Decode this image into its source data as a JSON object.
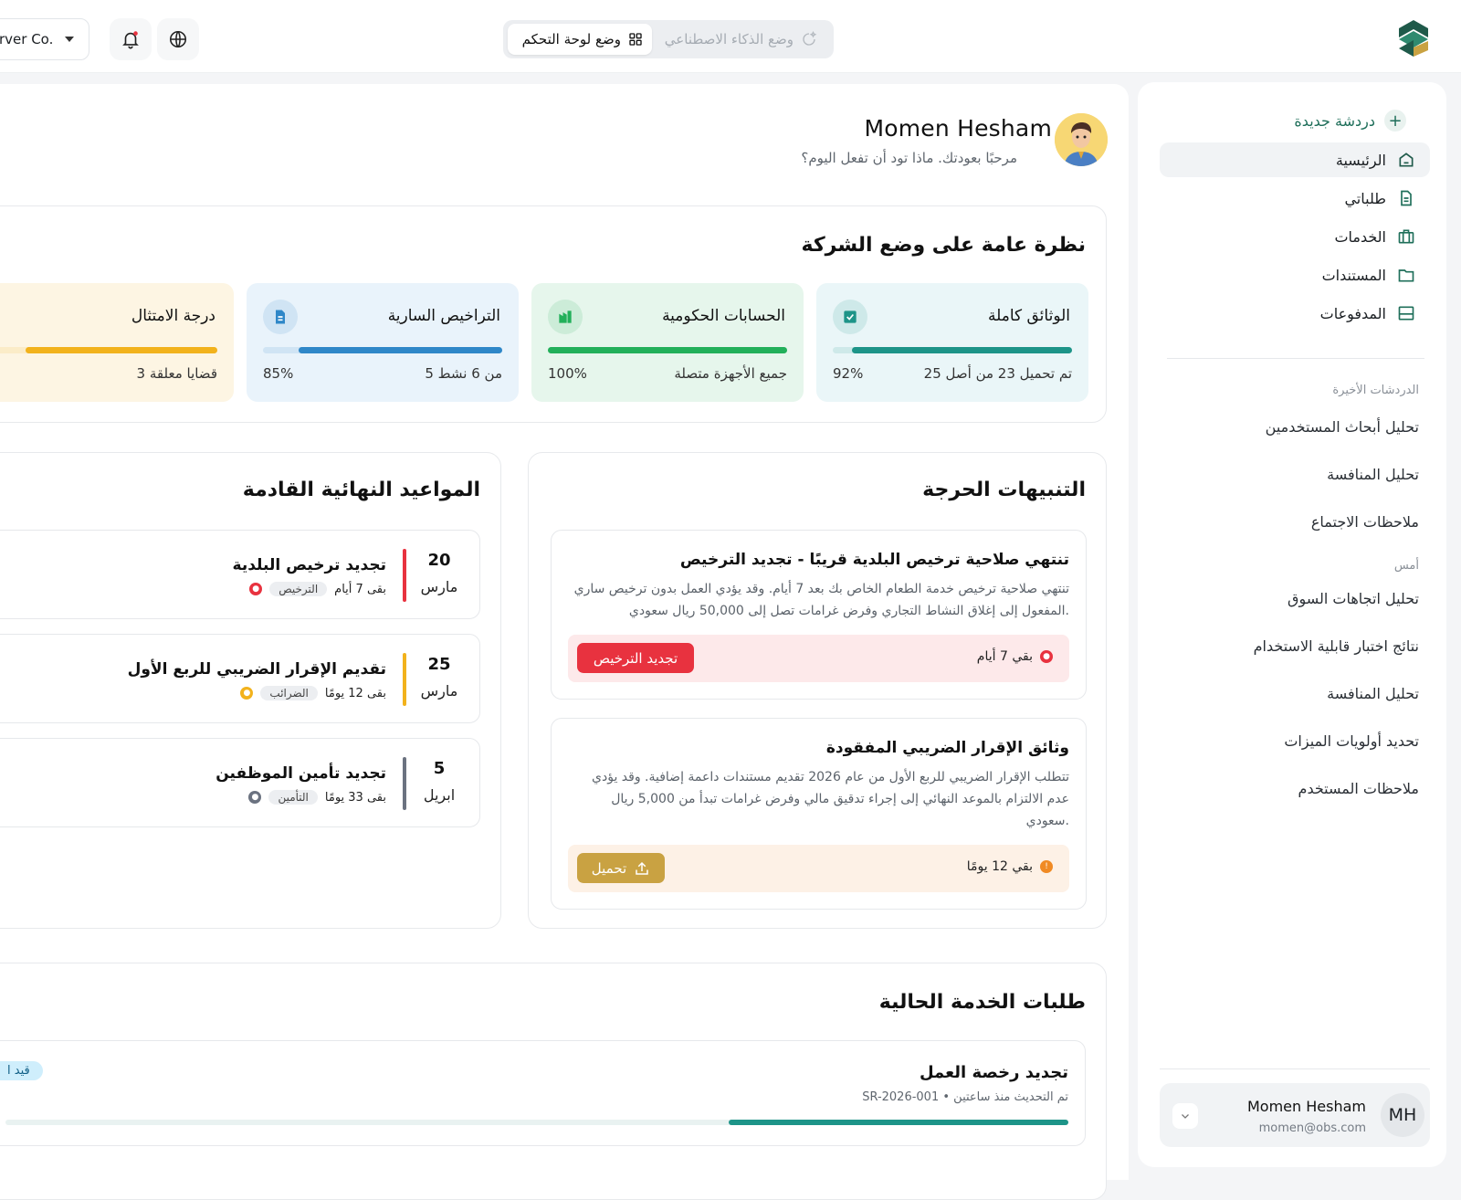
{
  "topbar": {
    "company": "rver Co.",
    "modes": {
      "ai": "وضع الذكاء الاصطناعي",
      "dashboard": "وضع لوحة التحكم"
    }
  },
  "sidebar": {
    "new_chat": "دردشة جديدة",
    "nav": [
      {
        "label": "الرئيسية",
        "icon": "home-icon"
      },
      {
        "label": "طلباتي",
        "icon": "document-icon"
      },
      {
        "label": "الخدمات",
        "icon": "briefcase-icon"
      },
      {
        "label": "المستندات",
        "icon": "folder-icon"
      },
      {
        "label": "المدفوعات",
        "icon": "wallet-icon"
      }
    ],
    "recent_label": "الدردشات الأخيرة",
    "recent": [
      "تحليل أبحاث المستخدمين",
      "تحليل المنافسة",
      "ملاحظات الاجتماع"
    ],
    "yesterday_label": "أمس",
    "yesterday": [
      "تحليل اتجاهات السوق",
      "نتائج اختبار قابلية الاستخدام",
      "تحليل المنافسة",
      "تحديد أولويات الميزات",
      "ملاحظات المستخدم"
    ],
    "user": {
      "initials": "MH",
      "name": "Momen Hesham",
      "email": "momen@obs.com"
    }
  },
  "greeting": {
    "name": "Momen Hesham",
    "subtitle": "مرحبًا بعودتك. ماذا تود أن تفعل اليوم؟"
  },
  "overview": {
    "title": "نظرة عامة على وضع الشركة",
    "cards": [
      {
        "title": "الوثائق كاملة",
        "sub": "تم تحميل 23 من أصل 25",
        "pct": "92%",
        "progress": 0.92,
        "color": "#1d9488",
        "bg": "#eaf6f8"
      },
      {
        "title": "الحسابات الحكومية",
        "sub": "جميع الأجهزة متصلة",
        "pct": "100%",
        "progress": 1.0,
        "color": "#22b05a",
        "bg": "#e6f6ec"
      },
      {
        "title": "التراخيص السارية",
        "sub": "5 من 6 نشط",
        "pct": "85%",
        "progress": 0.85,
        "color": "#2f87c8",
        "bg": "#e9f3fb"
      },
      {
        "title": "درجة الامتثال",
        "sub": "3 قضايا معلقة",
        "pct": "",
        "progress": 0.8,
        "color": "#f2b21c",
        "bg": "#fdf5e3"
      }
    ]
  },
  "alerts": {
    "title": "التنبيهات الحرجة",
    "items": [
      {
        "title": "تنتهي صلاحية ترخيص البلدية قريبًا - تجديد الترخيص",
        "body": "تنتهي صلاحية ترخيص خدمة الطعام الخاص بك بعد 7 أيام. وقد يؤدي العمل بدون ترخيص ساري المفعول إلى إغلاق النشاط التجاري وفرض غرامات تصل إلى 50,000 ريال سعودي.",
        "remaining": "بقي 7 أيام",
        "action": "تجديد الترخيص"
      },
      {
        "title": "وثائق الإقرار الضريبي المفقودة",
        "body": "تتطلب الإقرار الضريبي للربع الأول من عام 2026 تقديم مستندات داعمة إضافية. وقد يؤدي عدم الالتزام بالموعد النهائي إلى إجراء تدقيق مالي وفرض غرامات تبدأ من 5,000 ريال سعودي.",
        "remaining": "بقي 12 يومًا",
        "action": "تحميل"
      }
    ]
  },
  "deadlines": {
    "title": "المواعيد النهائية القادمة",
    "items": [
      {
        "day": "20",
        "month": "مارس",
        "title": "تجديد ترخيص البلدية",
        "tag": "الترخيص",
        "remaining": "بقى 7 أيام",
        "color": "#e8323f"
      },
      {
        "day": "25",
        "month": "مارس",
        "title": "تقديم الإقرار الضريبي للربع الأول",
        "tag": "الضرائب",
        "remaining": "بقى 12 يومًا",
        "color": "#f2b21c"
      },
      {
        "day": "5",
        "month": "ابريل",
        "title": "تجديد تأمين الموظفين",
        "tag": "التأمين",
        "remaining": "بقى 33 يومًا",
        "color": "#6b7280"
      }
    ]
  },
  "requests": {
    "title": "طلبات الخدمة الحالية",
    "items": [
      {
        "title": "تجديد رخصة العمل",
        "sub": "SR-2026-001 • تم التحديث منذ ساعتين",
        "status": "قيد ا",
        "progress": 0.32
      }
    ]
  }
}
